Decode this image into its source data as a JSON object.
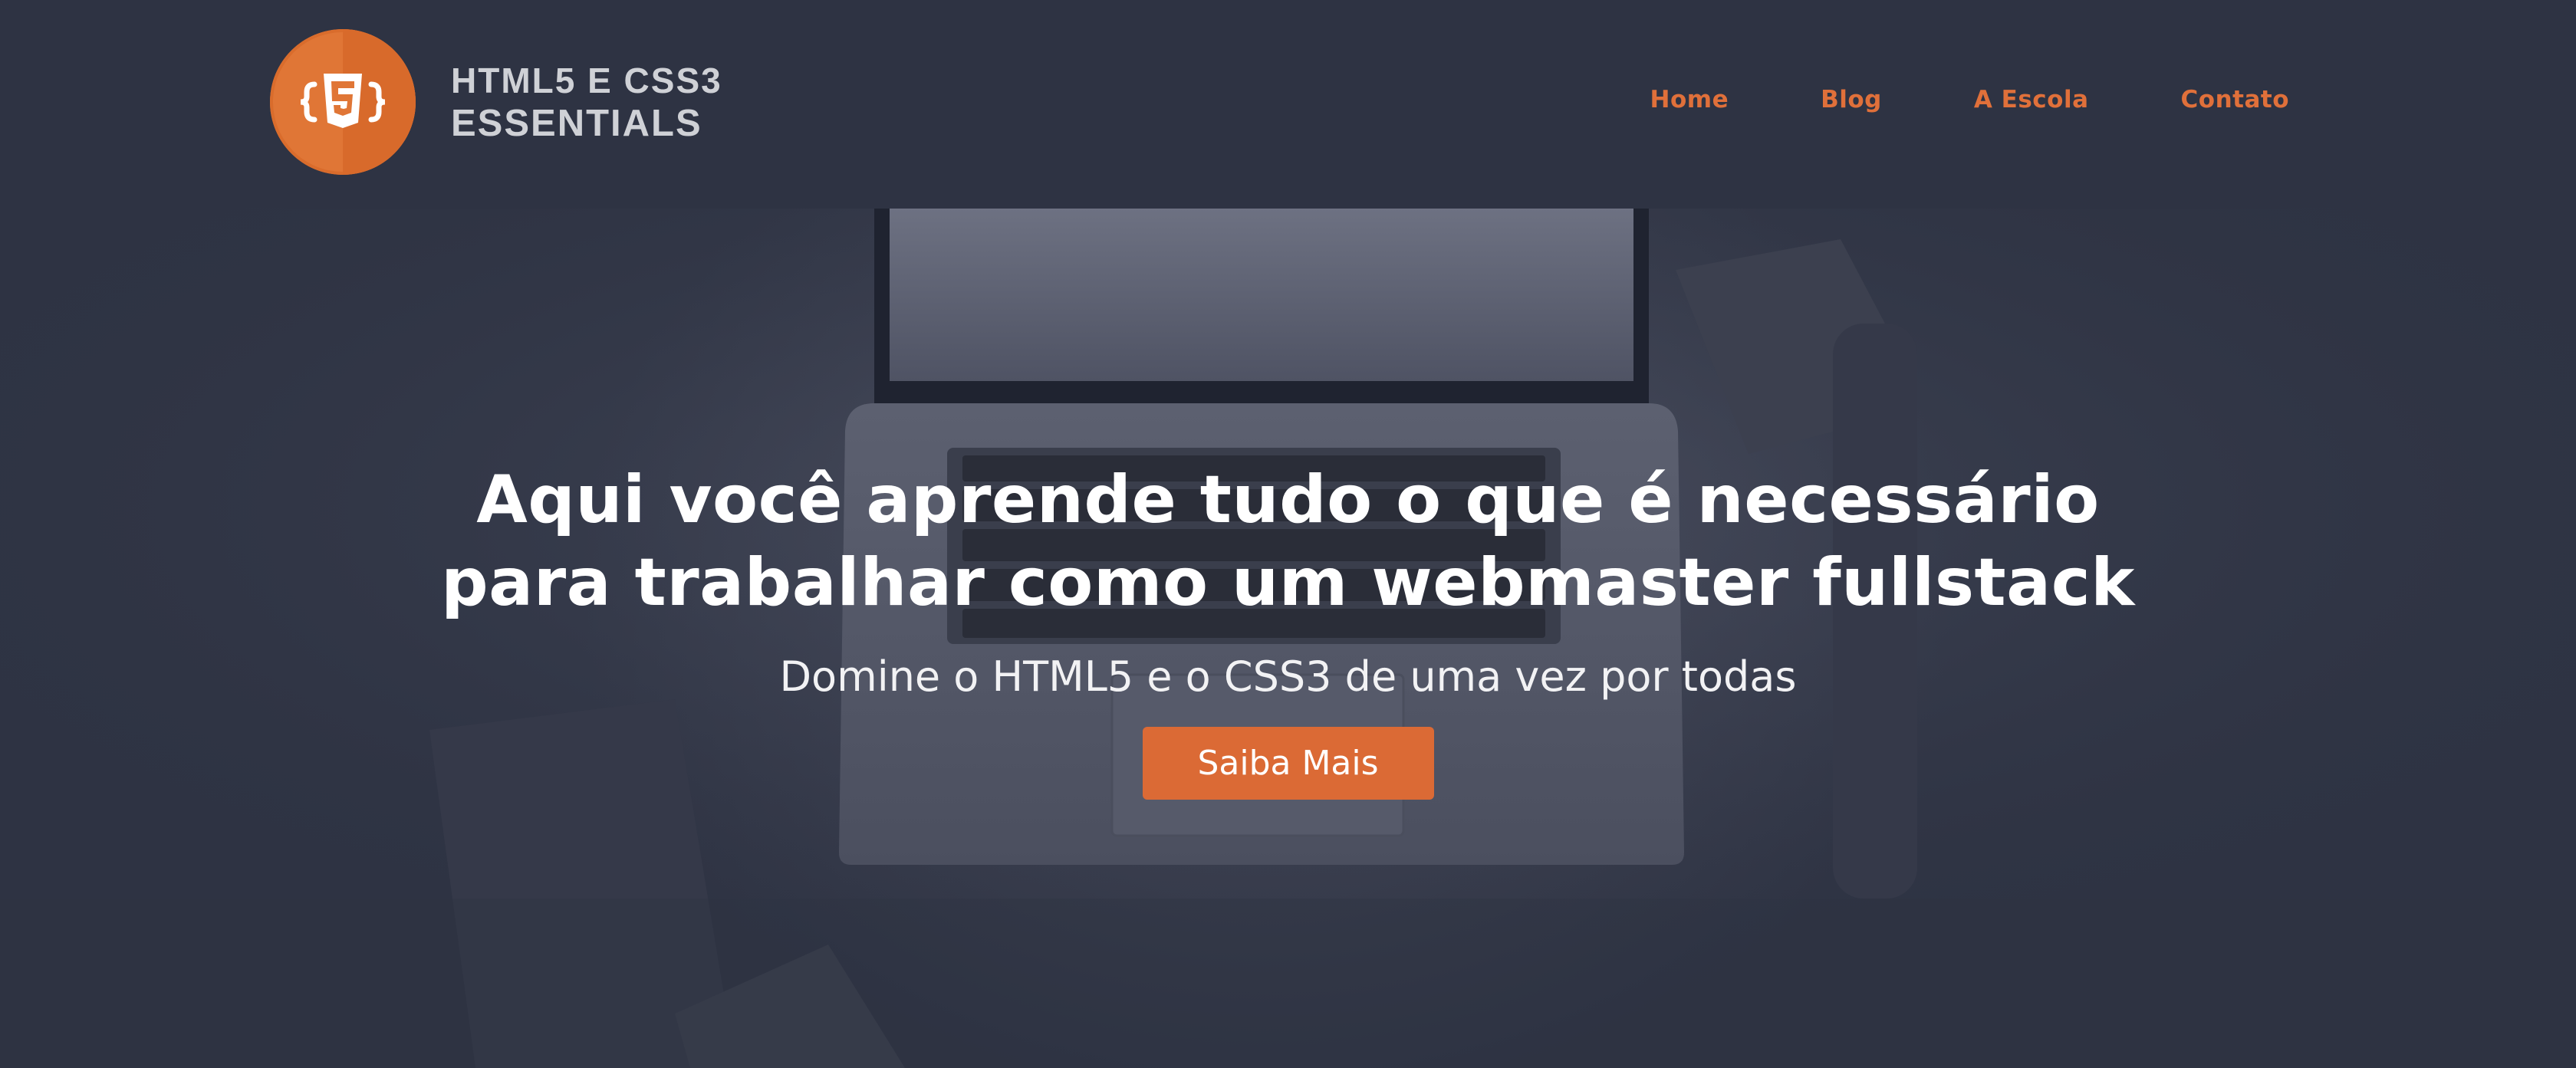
{
  "brand": {
    "line1": "HTML5 E CSS3",
    "line2": "ESSENTIALS",
    "badge_glyph": "{5}",
    "accent_color": "#e07636"
  },
  "nav": {
    "items": [
      {
        "label": "Home"
      },
      {
        "label": "Blog"
      },
      {
        "label": "A Escola"
      },
      {
        "label": "Contato"
      }
    ],
    "color": "#e0703a"
  },
  "hero": {
    "title_line1": "Aqui você aprende tudo o que é necessário",
    "title_line2": "para trabalhar como um webmaster fullstack",
    "subtitle": "Domine o HTML5 e o CSS3 de uma vez por todas",
    "cta_label": "Saiba Mais",
    "cta_color": "#db6a35",
    "background_color": "#2e3343"
  }
}
